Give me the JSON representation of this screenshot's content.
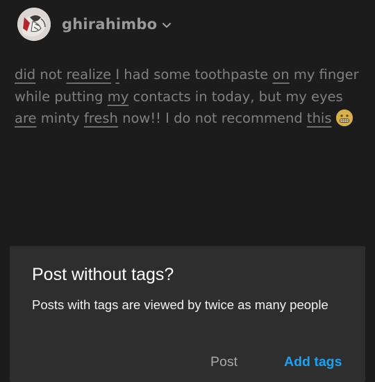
{
  "post": {
    "username": "ghirahimbo",
    "avatar_icon": "avatar-illustration",
    "chevron_icon": "chevron-down-icon",
    "text": {
      "w1": "did",
      "w2": " not ",
      "w3": "realize",
      "w4": " ",
      "w5": "I",
      "w6": " had some toothpaste ",
      "w7": "on",
      "w8": " my finger while putting ",
      "w9": "my",
      "w10": " contacts in today, but my eyes ",
      "w11": "are",
      "w12": " minty ",
      "w13": "fresh",
      "w14": " now!! I do not recommend ",
      "w15": "this",
      "w16": " "
    },
    "emoji_icon": "grimacing-face-emoji",
    "emoji_color": "#d7b24a"
  },
  "dialog": {
    "title": "Post without tags?",
    "message": "Posts with tags are viewed by twice as many people",
    "post_button": "Post",
    "add_tags_button": "Add tags"
  },
  "colors": {
    "background": "#1c1c1c",
    "dialog_background": "#2e2e2e",
    "accent": "#1aa3f5"
  }
}
